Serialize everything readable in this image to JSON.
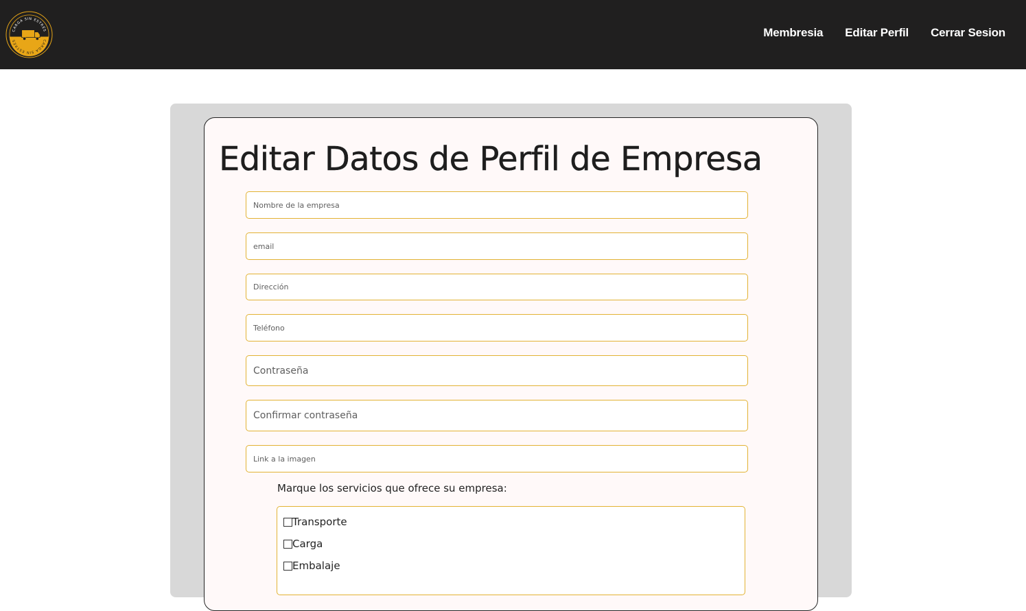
{
  "nav": {
    "logo_text_top": "CARGA SIN ESTRÉS",
    "logo_text_bottom": "CARGA SIN ESTRÉS",
    "links": [
      {
        "label": "Membresia"
      },
      {
        "label": "Editar Perfil"
      },
      {
        "label": "Cerrar Sesion"
      }
    ],
    "brand_color": "#e8a617"
  },
  "form": {
    "title": "Editar Datos de Perfil de Empresa",
    "fields": {
      "company_name": {
        "placeholder": "Nombre de la empresa",
        "value": ""
      },
      "email": {
        "placeholder": "email",
        "value": ""
      },
      "address": {
        "placeholder": "Dirección",
        "value": ""
      },
      "phone": {
        "placeholder": "Teléfono",
        "value": ""
      },
      "password": {
        "placeholder": "Contraseña",
        "value": ""
      },
      "confirm_password": {
        "placeholder": "Confirmar contraseña",
        "value": ""
      },
      "image_link": {
        "placeholder": "Link a la imagen",
        "value": ""
      }
    },
    "services_label": "Marque los servicios que ofrece su empresa:",
    "services": [
      {
        "label": "Transporte",
        "checked": false
      },
      {
        "label": "Carga",
        "checked": false
      },
      {
        "label": "Embalaje",
        "checked": false
      }
    ],
    "accent_color": "#e2b233"
  }
}
